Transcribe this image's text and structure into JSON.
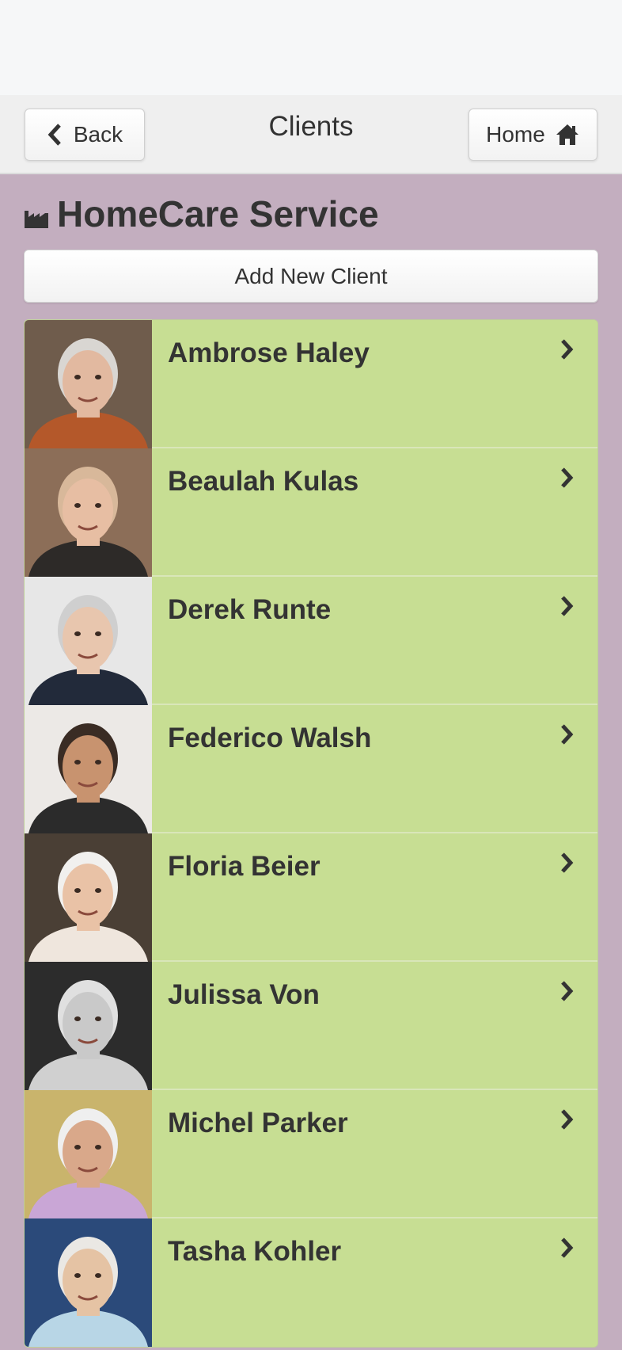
{
  "header": {
    "back_label": "Back",
    "title": "Clients",
    "home_label": "Home"
  },
  "brand": {
    "title": "HomeCare Service",
    "icon": "factory-icon"
  },
  "add_button_label": "Add New Client",
  "clients": [
    {
      "name": "Ambrose Haley",
      "photo": {
        "bg": "#6f5c4c",
        "skin": "#e2b9a0",
        "hair": "#d9d6d2",
        "shirt": "#b4582a"
      }
    },
    {
      "name": "Beaulah Kulas",
      "photo": {
        "bg": "#8c6e58",
        "skin": "#e7bea3",
        "hair": "#d8b89a",
        "shirt": "#2d2a28"
      }
    },
    {
      "name": "Derek Runte",
      "photo": {
        "bg": "#e7e7e7",
        "skin": "#e8c6ae",
        "hair": "#cfcfcf",
        "shirt": "#222a3a"
      }
    },
    {
      "name": "Federico Walsh",
      "photo": {
        "bg": "#ece9e6",
        "skin": "#c8936f",
        "hair": "#3a2c24",
        "shirt": "#2b2b2b"
      }
    },
    {
      "name": "Floria Beier",
      "photo": {
        "bg": "#4a3f35",
        "skin": "#e9c2a6",
        "hair": "#f1f0ee",
        "shirt": "#efe6dd"
      }
    },
    {
      "name": "Julissa Von",
      "photo": {
        "bg": "#2c2c2c",
        "skin": "#c9c9c9",
        "hair": "#e0e0e0",
        "shirt": "#d0d0d0"
      }
    },
    {
      "name": "Michel Parker",
      "photo": {
        "bg": "#c9b46c",
        "skin": "#d9a88a",
        "hair": "#efefef",
        "shirt": "#c9a6d6"
      }
    },
    {
      "name": "Tasha Kohler",
      "photo": {
        "bg": "#2b4a7a",
        "skin": "#e5c3a4",
        "hair": "#eae8e4",
        "shirt": "#b8d6e6"
      }
    }
  ],
  "colors": {
    "page_bg": "#c3aebf",
    "list_item_bg": "#c7de93",
    "header_bg": "#efefef",
    "text": "#333333"
  },
  "icons": {
    "back": "chevron-left-icon",
    "home": "home-icon",
    "row": "chevron-right-icon"
  }
}
